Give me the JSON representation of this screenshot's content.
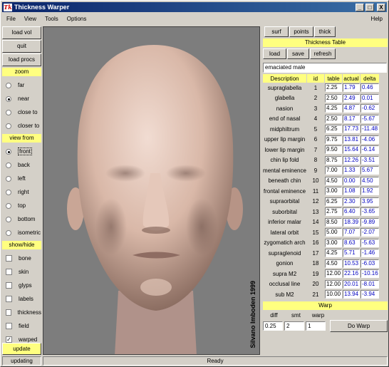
{
  "app": {
    "title": "Thickness Warper",
    "icon_text": "Tk",
    "min_label": "_",
    "max_label": "□",
    "close_label": "X"
  },
  "menu": {
    "file": "File",
    "view": "View",
    "tools": "Tools",
    "options": "Options",
    "help": "Help"
  },
  "left": {
    "load_vol": "load vol",
    "quit": "quit",
    "load_procs": "load procs",
    "zoom_header": "zoom",
    "zoom_options": [
      "far",
      "near",
      "close to",
      "closer to"
    ],
    "zoom_selected": "near",
    "view_header": "view from",
    "view_options": [
      "front",
      "back",
      "left",
      "right",
      "top",
      "bottom",
      "isometric"
    ],
    "view_selected": "front",
    "show_header": "show/hide",
    "show_options": [
      "bone",
      "skin",
      "glyps",
      "labels",
      "thickness",
      "field",
      "warped"
    ],
    "show_checked": [
      "warped"
    ],
    "update": "update",
    "updating": "updating"
  },
  "viewport": {
    "credit": "Silvano Imboden 1999",
    "colors": {
      "background": "#7d7d7d",
      "skin": "#d9b8a8"
    }
  },
  "status": "Ready",
  "right": {
    "tabs": [
      "surf",
      "points",
      "thick"
    ],
    "table_title": "Thickness Table",
    "actions": [
      "load",
      "save",
      "refresh"
    ],
    "profile": "emaciated male",
    "columns": [
      "Description",
      "id",
      "table",
      "actual",
      "delta"
    ],
    "rows": [
      {
        "desc": "supraglabella",
        "id": "1",
        "table": "2.25",
        "actual": "1.79",
        "delta": "0.46"
      },
      {
        "desc": "glabella",
        "id": "2",
        "table": "2.50",
        "actual": "2.49",
        "delta": "0.01"
      },
      {
        "desc": "nasion",
        "id": "3",
        "table": "4.25",
        "actual": "4.87",
        "delta": "-0.62"
      },
      {
        "desc": "end of nasal",
        "id": "4",
        "table": "2.50",
        "actual": "8.17",
        "delta": "-5.67"
      },
      {
        "desc": "midphiltrum",
        "id": "5",
        "table": "6.25",
        "actual": "17.73",
        "delta": "-11.48"
      },
      {
        "desc": "upper lip margin",
        "id": "6",
        "table": "9.75",
        "actual": "13.81",
        "delta": "-4.06"
      },
      {
        "desc": "lower lip margin",
        "id": "7",
        "table": "9.50",
        "actual": "15.64",
        "delta": "-6.14"
      },
      {
        "desc": "chin lip fold",
        "id": "8",
        "table": "8.75",
        "actual": "12.26",
        "delta": "-3.51"
      },
      {
        "desc": "mental eminence",
        "id": "9",
        "table": "7.00",
        "actual": "1.33",
        "delta": "5.67"
      },
      {
        "desc": "beneath chin",
        "id": "10",
        "table": "4.50",
        "actual": "0.00",
        "delta": "4.50"
      },
      {
        "desc": "frontal eminence",
        "id": "11",
        "table": "3.00",
        "actual": "1.08",
        "delta": "1.92"
      },
      {
        "desc": "supraorbital",
        "id": "12",
        "table": "6.25",
        "actual": "2.30",
        "delta": "3.95"
      },
      {
        "desc": "suborbital",
        "id": "13",
        "table": "2.75",
        "actual": "6.40",
        "delta": "-3.65"
      },
      {
        "desc": "inferior malar",
        "id": "14",
        "table": "8.50",
        "actual": "18.39",
        "delta": "-9.89"
      },
      {
        "desc": "lateral orbit",
        "id": "15",
        "table": "5.00",
        "actual": "7.07",
        "delta": "-2.07"
      },
      {
        "desc": "zygomatich arch",
        "id": "16",
        "table": "3.00",
        "actual": "8.63",
        "delta": "-5.63"
      },
      {
        "desc": "supraglenoid",
        "id": "17",
        "table": "4.25",
        "actual": "5.71",
        "delta": "-1.46"
      },
      {
        "desc": "gonion",
        "id": "18",
        "table": "4.50",
        "actual": "10.53",
        "delta": "-6.03"
      },
      {
        "desc": "supra M2",
        "id": "19",
        "table": "12.00",
        "actual": "22.16",
        "delta": "-10.16"
      },
      {
        "desc": "occlusal line",
        "id": "20",
        "table": "12.00",
        "actual": "20.01",
        "delta": "-8.01"
      },
      {
        "desc": "sub M2",
        "id": "21",
        "table": "10.00",
        "actual": "13.94",
        "delta": "-3.94"
      }
    ],
    "warp": {
      "header": "Warp",
      "labels": [
        "diff",
        "smt",
        "warp"
      ],
      "values": [
        "0.25",
        "2",
        "1"
      ],
      "button": "Do Warp"
    }
  }
}
